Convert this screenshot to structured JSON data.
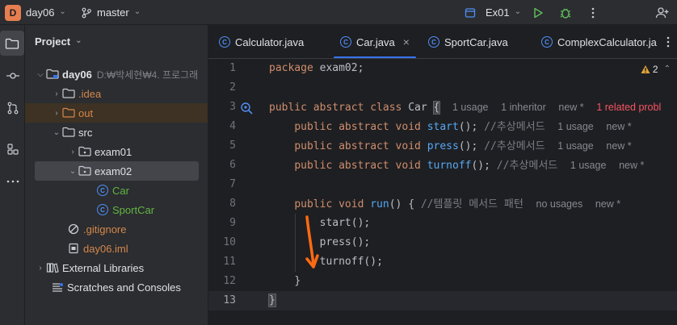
{
  "titlebar": {
    "project_badge": "D",
    "project_name": "day06",
    "branch": "master",
    "run_config": "Ex01",
    "icons": [
      "branch-icon",
      "run-config-icon",
      "run-icon",
      "debug-icon",
      "more-icon",
      "add-user-icon"
    ]
  },
  "sidebar": {
    "icons": [
      "folder-icon",
      "commit-icon",
      "pull-request-icon",
      "structure-icon",
      "more-icon"
    ]
  },
  "project": {
    "title": "Project",
    "tree": [
      {
        "label": "day06",
        "extra": "D:₩박세현₩4. 프로그래"
      },
      {
        "label": ".idea"
      },
      {
        "label": "out"
      },
      {
        "label": "src"
      },
      {
        "label": "exam01"
      },
      {
        "label": "exam02"
      },
      {
        "label": "Car"
      },
      {
        "label": "SportCar"
      },
      {
        "label": ".gitignore"
      },
      {
        "label": "day06.iml"
      },
      {
        "label": "External Libraries"
      },
      {
        "label": "Scratches and Consoles"
      }
    ]
  },
  "tabs": [
    {
      "label": "Calculator.java"
    },
    {
      "label": "Car.java",
      "active": true
    },
    {
      "label": "SportCar.java"
    },
    {
      "label": "ComplexCalculator.ja"
    }
  ],
  "editor": {
    "warning_count": "2",
    "line_numbers": [
      "1",
      "2",
      "3",
      "4",
      "5",
      "6",
      "7",
      "8",
      "9",
      "10",
      "11",
      "12",
      "13"
    ],
    "current_line": 13,
    "lines": {
      "l1": {
        "kw": "package",
        "rest": " exam02;"
      },
      "l3": {
        "kw": "public abstract class",
        "rest": " Car ",
        "brace": "{",
        "h1": "1 usage",
        "h2": "1 inheritor",
        "h3": "new *",
        "h4": "1 related probl"
      },
      "l4": {
        "kw": "public abstract void",
        "fn": "start",
        "rest": "(); ",
        "cm": "//추상메서드",
        "h1": "1 usage",
        "h2": "new *"
      },
      "l5": {
        "kw": "public abstract void",
        "fn": "press",
        "rest": "(); ",
        "cm": "//추상메서드",
        "h1": "1 usage",
        "h2": "new *"
      },
      "l6": {
        "kw": "public abstract void",
        "fn": "turnoff",
        "rest": "(); ",
        "cm": "//추상메서드",
        "h1": "1 usage",
        "h2": "new *"
      },
      "l8": {
        "kw": "public void",
        "fn": "run",
        "rest": "() { ",
        "cm": "//템플릿 메서드 패턴",
        "h1": "no usages",
        "h2": "new *"
      },
      "l9": {
        "text": "start();"
      },
      "l10": {
        "text": "press();"
      },
      "l11": {
        "text": "turnoff();"
      },
      "l12": {
        "text": "}"
      },
      "l13": {
        "text": "}"
      }
    }
  },
  "colors": {
    "accent": "#3574f0",
    "arrow": "#ff6a13",
    "keyword": "#cf8e6d",
    "method": "#56a8f5"
  }
}
